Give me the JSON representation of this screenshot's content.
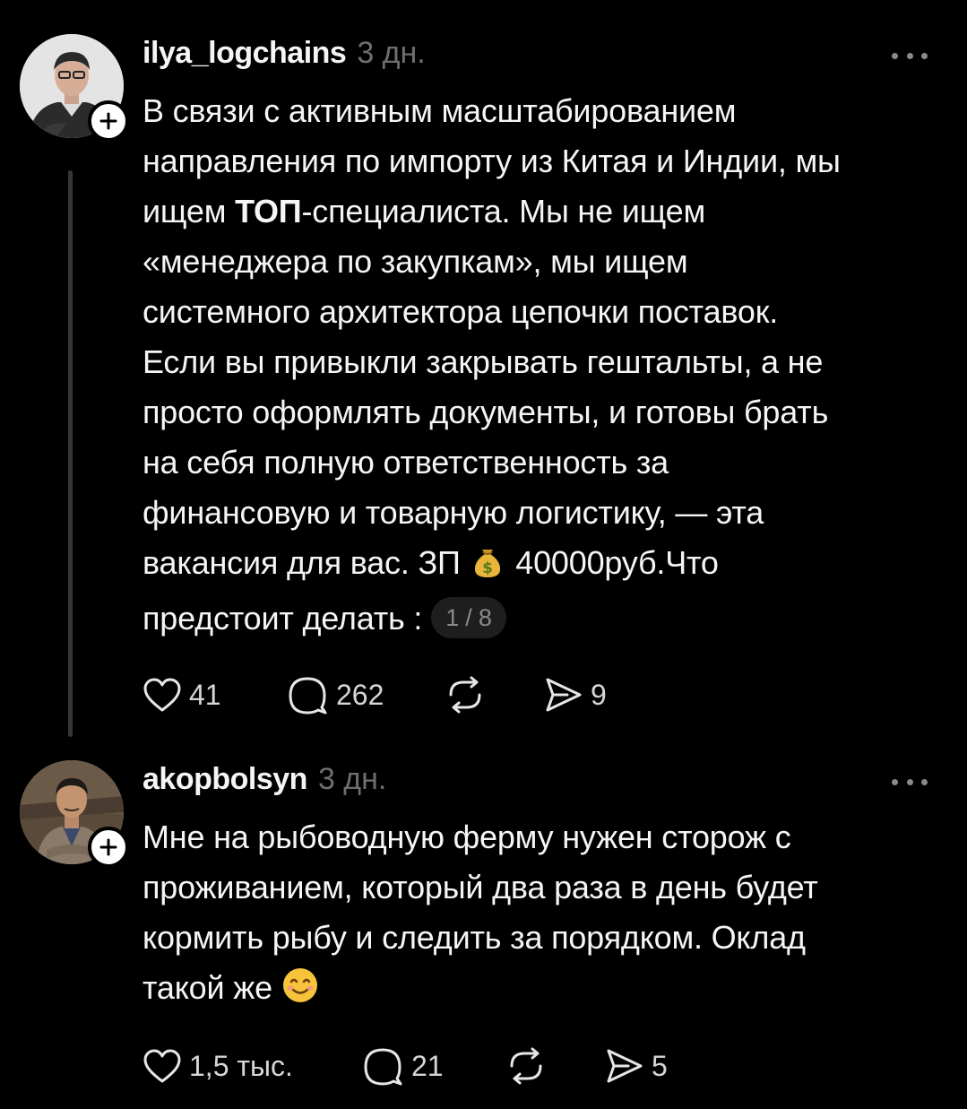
{
  "posts": [
    {
      "username": "ilya_logchains",
      "time": "3 дн.",
      "text_lines": [
        "В связи с активным масштабированием",
        "направления по импорту из Китая и Индии, мы",
        [
          "ищем ",
          "ТОП",
          "-специалиста. Мы не ищем"
        ],
        "«менеджера по закупкам», мы ищем",
        "системного архитектора цепочки поставок.",
        "Если вы привыкли закрывать гештальты, а не",
        "просто оформлять документы, и готовы брать",
        "на себя полную ответственность за",
        "финансовую и товарную логистику, — эта",
        [
          "вакансия для вас. ЗП ",
          "40000руб.Что"
        ],
        "предстоит делать :"
      ],
      "carousel_counter": "1 / 8",
      "emoji": "money-bag",
      "likes": "41",
      "comments": "262",
      "reposts": "",
      "shares": "9"
    },
    {
      "username": "akopbolsyn",
      "time": "3 дн.",
      "text_lines": [
        "Мне на рыбоводную ферму нужен сторож с",
        "проживанием, который два раза в день будет",
        "кормить рыбу и следить за порядком. Оклад",
        "такой же"
      ],
      "emoji": "smiling-face",
      "likes": "1,5 тыс.",
      "comments": "21",
      "reposts": "",
      "shares": "5"
    }
  ],
  "colors": {
    "background": "#000000",
    "text": "#f3f5f7",
    "secondary": "#6e6e6e",
    "thread_line": "#333638"
  }
}
